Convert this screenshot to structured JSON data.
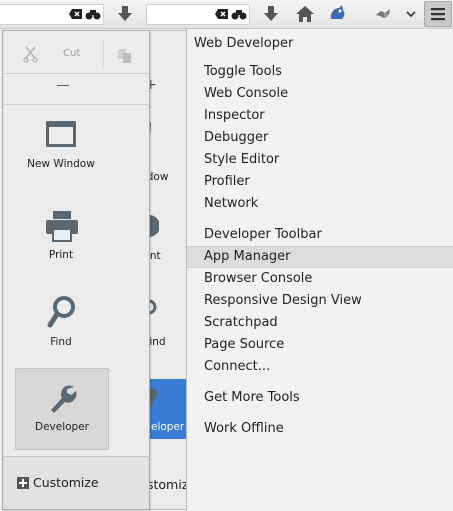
{
  "menu": {
    "title": "Web Developer",
    "items": [
      {
        "label": "Toggle Tools"
      },
      {
        "label": "Web Console"
      },
      {
        "label": "Inspector"
      },
      {
        "label": "Debugger"
      },
      {
        "label": "Style Editor"
      },
      {
        "label": "Profiler"
      },
      {
        "label": "Network"
      },
      {
        "label": "Developer Toolbar"
      },
      {
        "label": "App Manager"
      },
      {
        "label": "Browser Console"
      },
      {
        "label": "Responsive Design View"
      },
      {
        "label": "Scratchpad"
      },
      {
        "label": "Page Source"
      },
      {
        "label": "Connect..."
      },
      {
        "label": "Get More Tools"
      },
      {
        "label": "Work Offline"
      }
    ],
    "highlighted": "App Manager"
  },
  "panel": {
    "edit": {
      "cut": "Cut"
    },
    "zoom": {
      "minus": "—"
    },
    "tiles": {
      "new_window": "New Window",
      "print": "Print",
      "find": "Find",
      "developer": "Developer"
    },
    "customize": "Customize"
  },
  "ghost_panel": {
    "tiles": {
      "new_window_line1": "New Window",
      "new_window_line2": "Wi",
      "print": "Hint",
      "find": "Prefind",
      "developer": "eloper"
    },
    "plus": "+",
    "customize": "stomize"
  },
  "colors": {
    "accent_blue": "#3a7bd5",
    "icon_gray": "#5a6670",
    "menu_highlight": "#dcdcdc"
  }
}
